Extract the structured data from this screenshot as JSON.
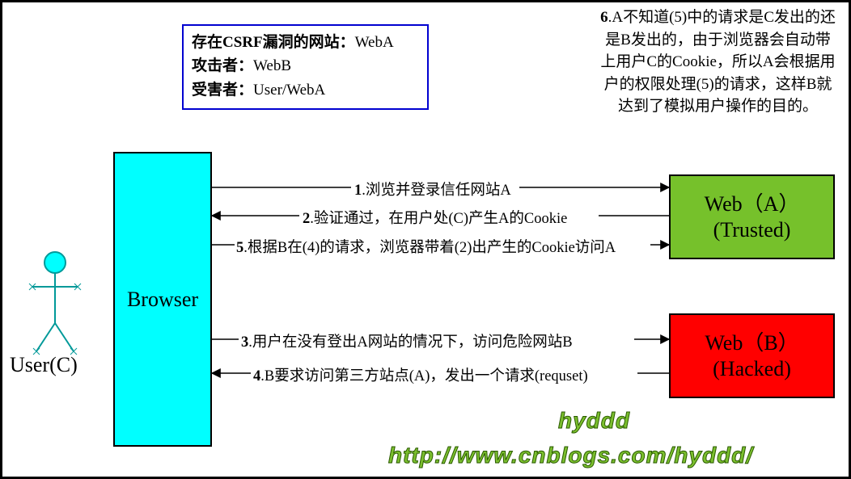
{
  "info": {
    "line1_key": "存在CSRF漏洞的网站：",
    "line1_val": "WebA",
    "line2_key": "攻击者：",
    "line2_val": "WebB",
    "line3_key": "受害者：",
    "line3_val": "User/WebA"
  },
  "note6": "6.A不知道(5)中的请求是C发出的还是B发出的，由于浏览器会自动带上用户C的Cookie，所以A会根据用户的权限处理(5)的请求，这样B就达到了模拟用户操作的目的。",
  "browser_label": "Browser",
  "user_label": "User(C)",
  "web_a": {
    "l1": "Web（A）",
    "l2": "(Trusted)"
  },
  "web_b": {
    "l1": "Web（B）",
    "l2": "(Hacked)"
  },
  "arrows": {
    "a1": {
      "num": "1",
      "text": ".浏览并登录信任网站A"
    },
    "a2": {
      "num": "2",
      "text": ".验证通过，在用户处(C)产生A的Cookie"
    },
    "a5": {
      "num": "5",
      "text": ".根据B在(4)的请求，浏览器带着(2)出产生的Cookie访问A"
    },
    "a3": {
      "num": "3",
      "text": ".用户在没有登出A网站的情况下，访问危险网站B"
    },
    "a4": {
      "num": "4",
      "text": ".B要求访问第三方站点(A)，发出一个请求(requset)"
    }
  },
  "watermark": {
    "name": "hyddd",
    "url": "http://www.cnblogs.com/hyddd/"
  }
}
